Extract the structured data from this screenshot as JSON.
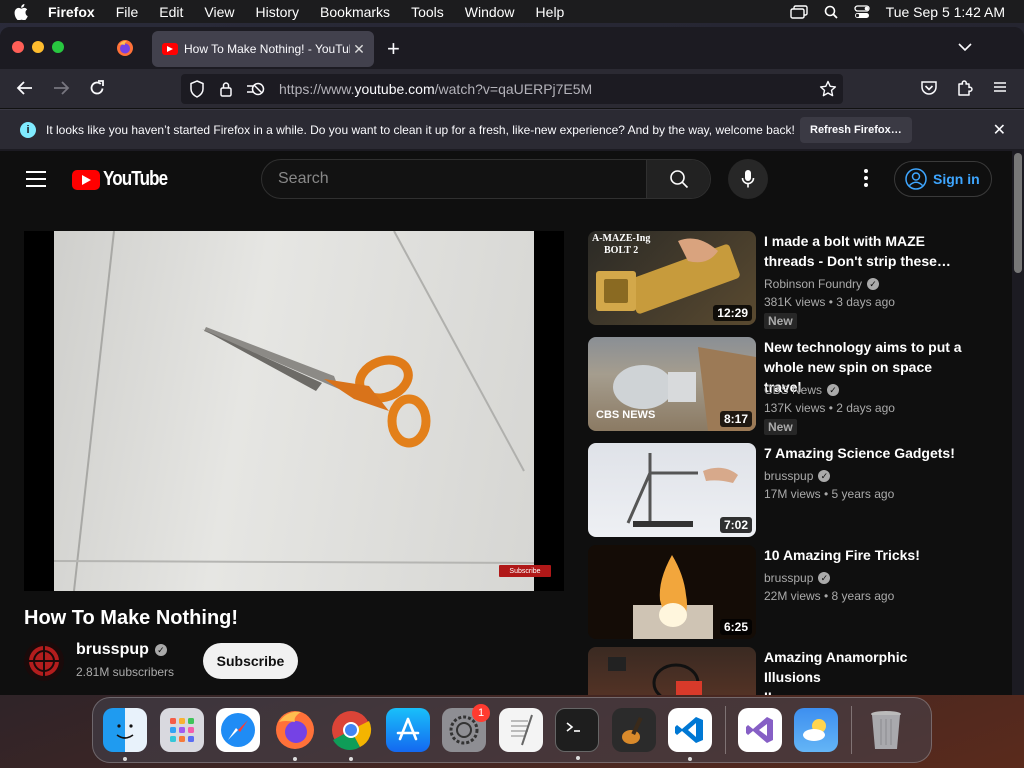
{
  "menubar": {
    "app_name": "Firefox",
    "items": [
      "File",
      "Edit",
      "View",
      "History",
      "Bookmarks",
      "Tools",
      "Window",
      "Help"
    ],
    "clock": "Tue Sep 5  1:42 AM"
  },
  "browser": {
    "tab_title": "How To Make Nothing! - YouTube",
    "url_prefix": "https://www.",
    "url_host": "youtube.com",
    "url_path": "/watch?v=qaUERPj7E5M",
    "notice_text": "It looks like you haven’t started Firefox in a while. Do you want to clean it up for a fresh, like-new experience? And by the way, welcome back!",
    "notice_button": "Refresh Firefox…"
  },
  "youtube": {
    "logo_text": "YouTube",
    "search_placeholder": "Search",
    "signin_label": "Sign in",
    "watermark": "Subscribe",
    "video_title": "How To Make Nothing!",
    "channel_name": "brusspup",
    "channel_subs": "2.81M subscribers",
    "subscribe_label": "Subscribe",
    "recommendations": [
      {
        "title_line1": "I made a bolt with MAZE",
        "title_line2": "threads - Don't strip these…",
        "channel": "Robinson Foundry",
        "meta": "381K views  •  3 days ago",
        "badge": "New",
        "duration": "12:29",
        "thumb_text1": "A-MAZE-Ing",
        "thumb_text2": "BOLT 2"
      },
      {
        "title_line1": "New technology aims to put a",
        "title_line2": "whole new spin on space travel",
        "channel": "CBS News",
        "meta": "137K views  •  2 days ago",
        "badge": "New",
        "duration": "8:17",
        "thumb_text1": "CBS NEWS"
      },
      {
        "title_line1": "7 Amazing Science Gadgets!",
        "title_line2": "",
        "channel": "brusspup",
        "meta": "17M views  •  5 years ago",
        "duration": "7:02"
      },
      {
        "title_line1": "10 Amazing Fire Tricks!",
        "title_line2": "",
        "channel": "brusspup",
        "meta": "22M views  •  8 years ago",
        "duration": "6:25"
      },
      {
        "title_line1": "Amazing Anamorphic Illusions",
        "title_line2": "II"
      }
    ]
  },
  "dock": {
    "apps": [
      "finder",
      "launchpad",
      "safari",
      "firefox",
      "chrome",
      "app-store",
      "system-settings",
      "textedit",
      "terminal",
      "garageband",
      "vscode",
      "visual-studio",
      "weather",
      "trash"
    ],
    "settings_badge": "1"
  }
}
